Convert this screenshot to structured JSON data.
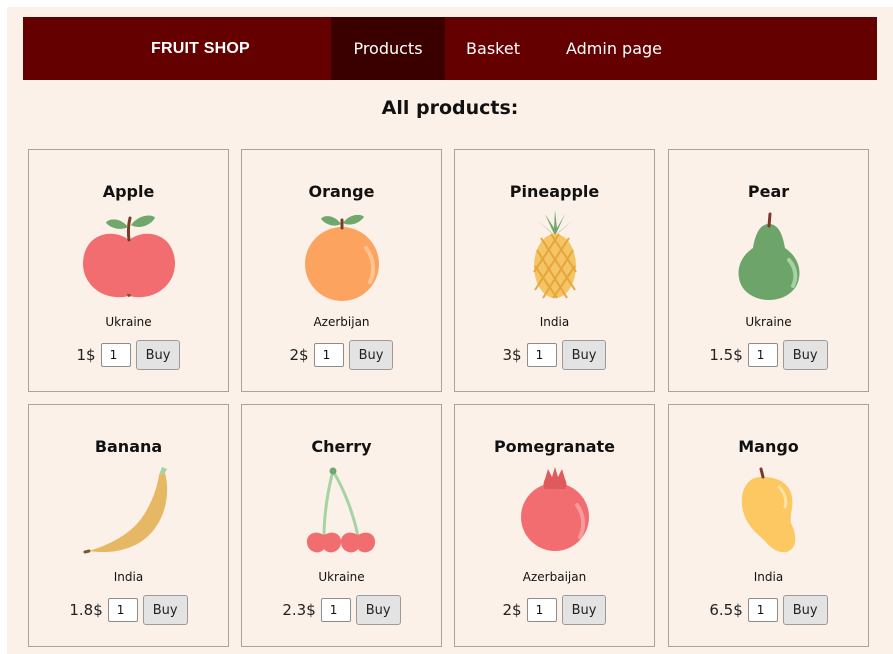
{
  "nav": {
    "brand": "FRUIT SHOP",
    "items": [
      {
        "label": "Products",
        "active": true
      },
      {
        "label": "Basket",
        "active": false
      },
      {
        "label": "Admin page",
        "active": false
      }
    ]
  },
  "main": {
    "title": "All products:",
    "buy_label": "Buy",
    "products": [
      {
        "name": "Apple",
        "country": "Ukraine",
        "price": "1$",
        "qty": "1",
        "icon": "apple-icon"
      },
      {
        "name": "Orange",
        "country": "Azerbijan",
        "price": "2$",
        "qty": "1",
        "icon": "orange-icon"
      },
      {
        "name": "Pineapple",
        "country": "India",
        "price": "3$",
        "qty": "1",
        "icon": "pineapple-icon"
      },
      {
        "name": "Pear",
        "country": "Ukraine",
        "price": "1.5$",
        "qty": "1",
        "icon": "pear-icon"
      },
      {
        "name": "Banana",
        "country": "India",
        "price": "1.8$",
        "qty": "1",
        "icon": "banana-icon"
      },
      {
        "name": "Cherry",
        "country": "Ukraine",
        "price": "2.3$",
        "qty": "1",
        "icon": "cherry-icon"
      },
      {
        "name": "Pomegranate",
        "country": "Azerbaijan",
        "price": "2$",
        "qty": "1",
        "icon": "pomegranate-icon"
      },
      {
        "name": "Mango",
        "country": "India",
        "price": "6.5$",
        "qty": "1",
        "icon": "mango-icon"
      }
    ]
  },
  "colors": {
    "navbar": "#650000",
    "nav_active": "#3a0000",
    "background": "#fcf1e9"
  }
}
